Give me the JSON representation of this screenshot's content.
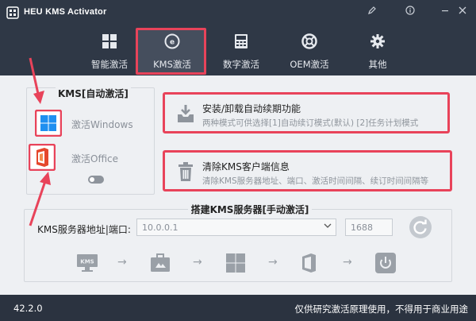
{
  "app": {
    "title": "HEU KMS Activator",
    "version": "42.2.0",
    "footer_note": "仅供研究激活原理使用，不得用于商业用途"
  },
  "window_controls": [
    "edit-icon",
    "info-icon",
    "minimize-icon",
    "close-icon"
  ],
  "tabs": [
    {
      "label": "智能激活",
      "icon": "grid-icon",
      "active": false
    },
    {
      "label": "KMS激活",
      "icon": "kms-icon",
      "active": true
    },
    {
      "label": "数字激活",
      "icon": "calculator-icon",
      "active": false
    },
    {
      "label": "OEM激活",
      "icon": "lifebuoy-icon",
      "active": false
    },
    {
      "label": "其他",
      "icon": "gear-icon",
      "active": false
    }
  ],
  "kms_auto": {
    "title": "KMS[自动激活]",
    "windows_label": "激活Windows",
    "office_label": "激活Office"
  },
  "features": [
    {
      "title": "安装/卸载自动续期功能",
      "desc": "两种模式可供选择[1]自动续订模式(默认) [2]任务计划模式",
      "icon": "install-icon"
    },
    {
      "title": "清除KMS客户端信息",
      "desc": "清除KMS服务器地址、端口、激活时间间隔、续订时间间隔等",
      "icon": "trash-icon"
    }
  ],
  "manual": {
    "title": "搭建KMS服务器[手动激活]",
    "server_label": "KMS服务器地址|端口:",
    "server_value": "10.0.0.1",
    "port_value": "1688",
    "flow": [
      "kms-server-icon",
      "briefcase-icon",
      "windows-icon",
      "office-icon",
      "power-icon"
    ]
  },
  "colors": {
    "header_bg": "#2f3846",
    "highlight": "#e8435a",
    "content_bg": "#eef0f3",
    "windows_blue": "#1f8ff0",
    "office_red": "#e5472c"
  }
}
